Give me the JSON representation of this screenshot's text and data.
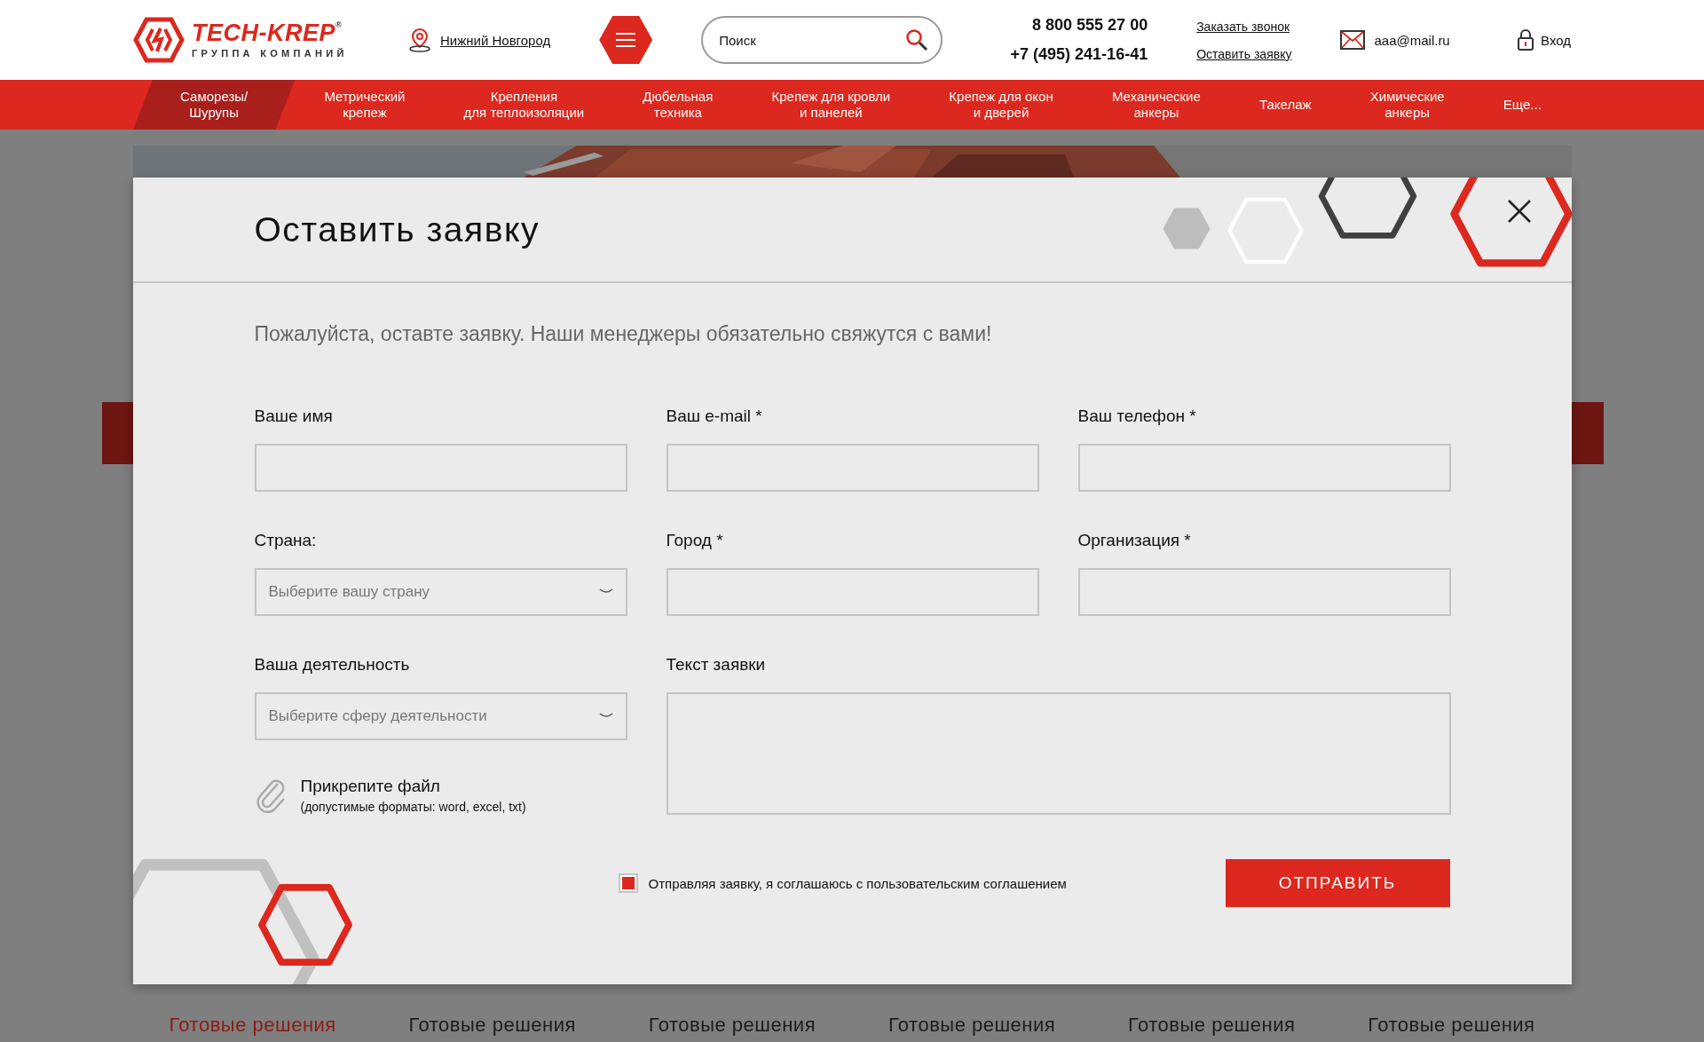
{
  "header": {
    "logo": {
      "name": "TECH-KREP",
      "mark": "®",
      "tagline": "ГРУППА КОМПАНИЙ"
    },
    "city": "Нижний Новгород",
    "search": {
      "placeholder": "Поиск"
    },
    "phones": [
      "8 800 555 27 00",
      "+7 (495) 241-16-41"
    ],
    "links": [
      "Заказать звонок",
      "Оставить заявку"
    ],
    "email": "aaa@mail.ru",
    "login": "Вход"
  },
  "nav": [
    {
      "label": "Саморезы/\nШурупы",
      "selected": true
    },
    {
      "label": "Метрический\nкрепеж",
      "selected": false
    },
    {
      "label": "Крепления\nдля теплоизоляции",
      "selected": false
    },
    {
      "label": "Дюбельная\nтехника",
      "selected": false
    },
    {
      "label": "Крепеж для кровли\nи панелей",
      "selected": false
    },
    {
      "label": "Крепеж для окон\nи дверей",
      "selected": false
    },
    {
      "label": "Механические\nанкеры",
      "selected": false
    },
    {
      "label": "Такелаж",
      "selected": false
    },
    {
      "label": "Химические\nанкеры",
      "selected": false
    },
    {
      "label": "Еще...",
      "selected": false
    }
  ],
  "dialog": {
    "title": "Оставить заявку",
    "intro": "Пожалуйста, оставте заявку. Наши менеджеры обязательно свяжутся с вами!",
    "fields": [
      {
        "label": "Ваше имя",
        "kind": "text"
      },
      {
        "label": "Ваш e-mail *",
        "kind": "text"
      },
      {
        "label": "Ваш телефон *",
        "kind": "text"
      },
      {
        "label": "Страна:",
        "kind": "select",
        "placeholder": "Выберите вашу страну"
      },
      {
        "label": "Город *",
        "kind": "text"
      },
      {
        "label": "Организация *",
        "kind": "text"
      },
      {
        "label": "Ваша деятельность",
        "kind": "select",
        "placeholder": "Выберите сферу деятельности"
      },
      {
        "label": "Текст заявки",
        "kind": "textarea"
      }
    ],
    "attach": {
      "label": "Прикрепите файл",
      "hint": "(допустимые форматы: word, excel, txt)"
    },
    "consent": {
      "text": "Отправляя заявку, я соглашаюсь с пользовательским соглашением",
      "checked": true
    },
    "submit": "ОТПРАВИТЬ"
  },
  "tabs": [
    {
      "label": "Готовые решения",
      "selected": true
    },
    {
      "label": "Готовые решения",
      "selected": false
    },
    {
      "label": "Готовые решения",
      "selected": false
    },
    {
      "label": "Готовые решения",
      "selected": false
    },
    {
      "label": "Готовые решения",
      "selected": false
    },
    {
      "label": "Готовые решения",
      "selected": false
    }
  ]
}
